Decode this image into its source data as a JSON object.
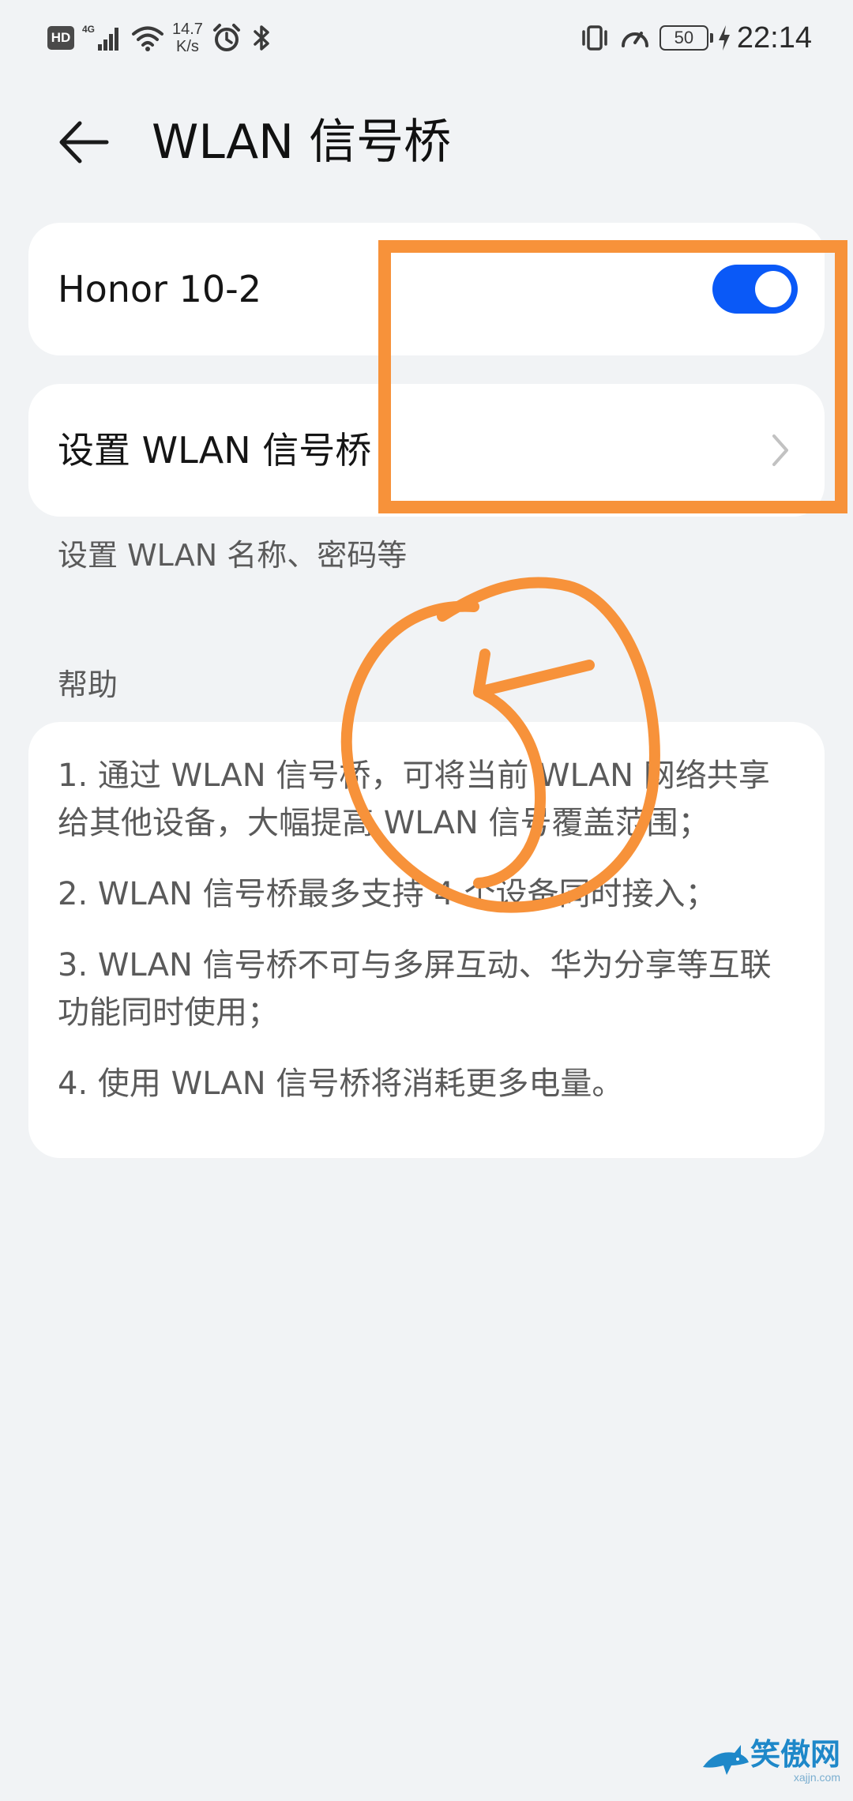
{
  "status_bar": {
    "hd_badge": "HD",
    "network": "4G",
    "speed_value": "14.7",
    "speed_unit": "K/s",
    "battery_level": "50",
    "time": "22:14",
    "icons": [
      "hd-icon",
      "signal-4g-icon",
      "wifi-icon",
      "alarm-icon",
      "bluetooth-icon",
      "vibrate-icon",
      "speedometer-icon",
      "battery-icon",
      "charging-bolt-icon"
    ]
  },
  "header": {
    "title": "WLAN 信号桥",
    "back_icon": "back-arrow-icon"
  },
  "device_row": {
    "label": "Honor 10-2",
    "toggle_on": true,
    "accent_color": "#0a59f7"
  },
  "setup_row": {
    "label": "设置 WLAN 信号桥",
    "subtext": "设置 WLAN 名称、密码等"
  },
  "help": {
    "section_title": "帮助",
    "items": [
      "1. 通过 WLAN 信号桥，可将当前 WLAN 网络共享给其他设备，大幅提高 WLAN 信号覆盖范围；",
      "2. WLAN 信号桥最多支持 4 个设备同时接入；",
      "3. WLAN 信号桥不可与多屏互动、华为分享等互联功能同时使用；",
      "4. 使用 WLAN 信号桥将消耗更多电量。"
    ]
  },
  "annotation": {
    "color": "#f7923a"
  },
  "watermark": {
    "main": "笑傲网",
    "sub": "xajjn.com",
    "icon": "shark-logo-icon"
  }
}
